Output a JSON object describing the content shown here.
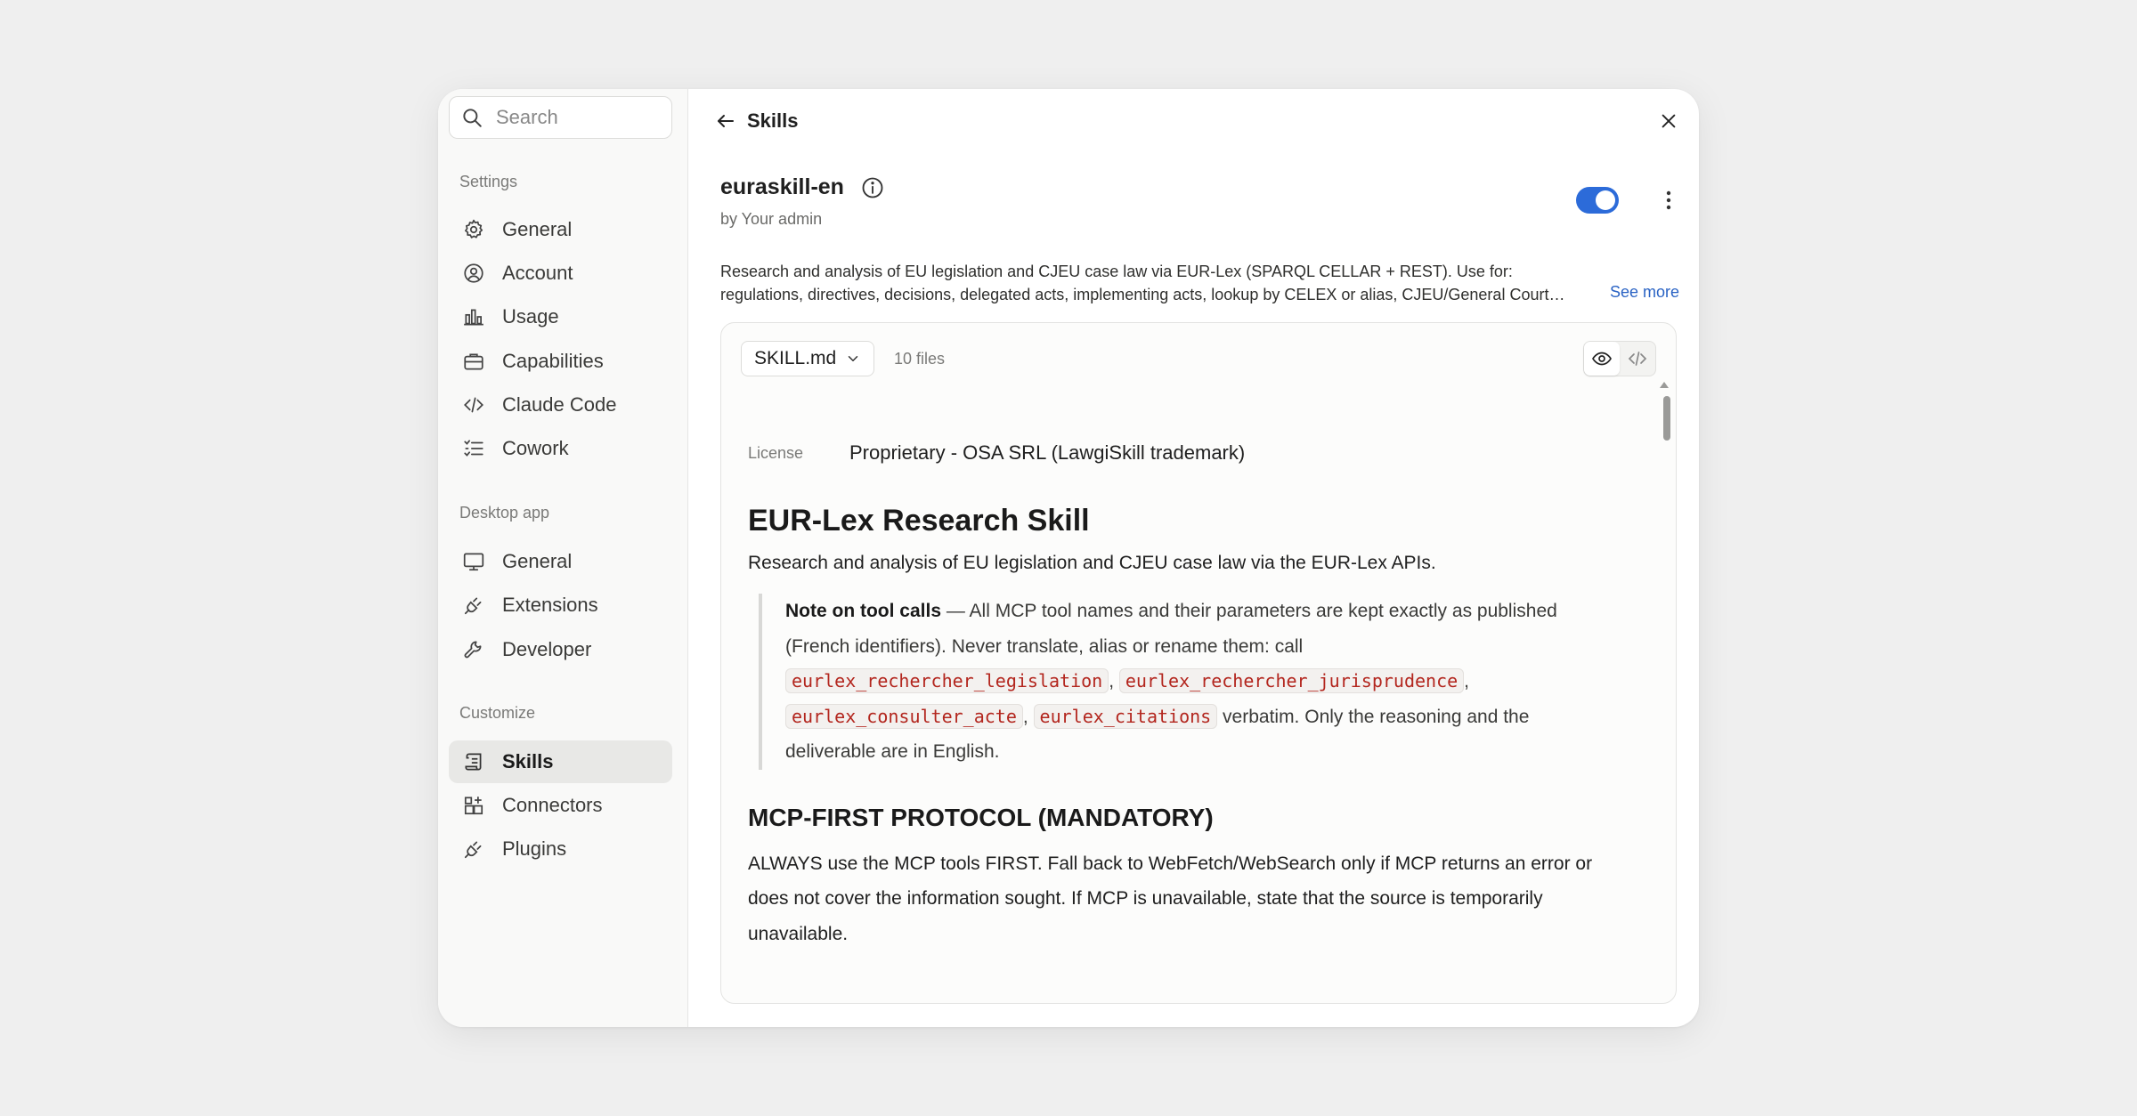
{
  "sidebar": {
    "search_placeholder": "Search",
    "sections": [
      {
        "label": "Settings"
      },
      {
        "label": "Desktop app"
      },
      {
        "label": "Customize"
      }
    ],
    "items": [
      {
        "label": "General"
      },
      {
        "label": "Account"
      },
      {
        "label": "Usage"
      },
      {
        "label": "Capabilities"
      },
      {
        "label": "Claude Code"
      },
      {
        "label": "Cowork"
      },
      {
        "label": "General"
      },
      {
        "label": "Extensions"
      },
      {
        "label": "Developer"
      },
      {
        "label": "Skills"
      },
      {
        "label": "Connectors"
      },
      {
        "label": "Plugins"
      }
    ]
  },
  "header": {
    "back_label": "Skills"
  },
  "skill": {
    "name": "euraskill-en",
    "author": "by Your admin",
    "enabled": true,
    "description_line1": "Research and analysis of EU legislation and CJEU case law via EUR-Lex (SPARQL CELLAR + REST). Use for:",
    "description_line2": "regulations, directives, decisions, delegated acts, implementing acts, lookup by CELEX or alias, CJEU/General Court…",
    "see_more": "See more"
  },
  "viewer": {
    "file_name": "SKILL.md",
    "file_count": "10 files",
    "license_label": "License",
    "license_value": "Proprietary - OSA SRL (LawgiSkill trademark)",
    "h1": "EUR-Lex Research Skill",
    "lead": "Research and analysis of EU legislation and CJEU case law via the EUR-Lex APIs.",
    "note": {
      "bold": "Note on tool calls",
      "text1": " — All MCP tool names and their parameters are kept exactly as published (French identifiers). Never translate, alias or rename them: call ",
      "code1": "eurlex_rechercher_legislation",
      "sep1": ", ",
      "code2": "eurlex_rechercher_jurisprudence",
      "sep2": ", ",
      "code3": "eurlex_consulter_acte",
      "sep3": ", ",
      "code4": "eurlex_citations",
      "text2": " verbatim. Only the reasoning and the deliverable are in English."
    },
    "h2": "MCP-FIRST PROTOCOL (MANDATORY)",
    "para": "ALWAYS use the MCP tools FIRST. Fall back to WebFetch/WebSearch only if MCP returns an error or does not cover the information sought. If MCP is unavailable, state that the source is temporarily unavailable."
  },
  "colors": {
    "accent": "#2c6bd9",
    "code_text": "#b3261e",
    "link": "#2a63c4"
  }
}
